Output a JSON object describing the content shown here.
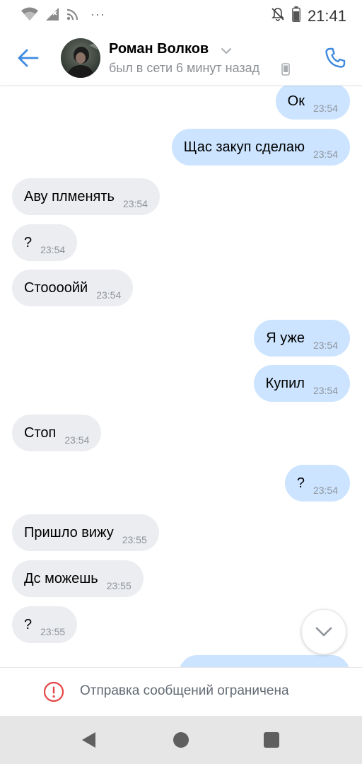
{
  "status_bar": {
    "time": "21:41",
    "dots": "···"
  },
  "header": {
    "name": "Роман Волков",
    "status": "был в сети 6 минут назад"
  },
  "messages": [
    {
      "dir": "out",
      "text": "Ок",
      "time": "23:54"
    },
    {
      "dir": "out",
      "text": "Щас закуп сделаю",
      "time": "23:54"
    },
    {
      "dir": "in",
      "text": "Аву плменять",
      "time": "23:54"
    },
    {
      "dir": "in",
      "text": "?",
      "time": "23:54"
    },
    {
      "dir": "in",
      "text": "Стоооойй",
      "time": "23:54"
    },
    {
      "dir": "out",
      "text": "Я уже",
      "time": "23:54"
    },
    {
      "dir": "out",
      "text": "Купил",
      "time": "23:54"
    },
    {
      "dir": "in",
      "text": "Стоп",
      "time": "23:54"
    },
    {
      "dir": "out",
      "text": "?",
      "time": "23:54"
    },
    {
      "dir": "in",
      "text": "Пришло вижу",
      "time": "23:55"
    },
    {
      "dir": "in",
      "text": "Дс можешь",
      "time": "23:55"
    },
    {
      "dir": "in",
      "text": "?",
      "time": "23:55"
    },
    {
      "dir": "out",
      "text": "",
      "time": ""
    }
  ],
  "footer": {
    "restriction_text": "Отправка сообщений ограничена"
  },
  "colors": {
    "accent": "#3f8ae0",
    "incoming_bubble": "#ebedf0",
    "outgoing_bubble": "#cce4ff",
    "warning": "#e64646"
  },
  "icons": {
    "back": "arrow-left-icon",
    "call": "phone-icon",
    "chevron": "chevron-down-icon",
    "device": "mobile-device-icon",
    "scroll": "chevron-down-icon",
    "restriction": "exclamation-circle-icon"
  }
}
